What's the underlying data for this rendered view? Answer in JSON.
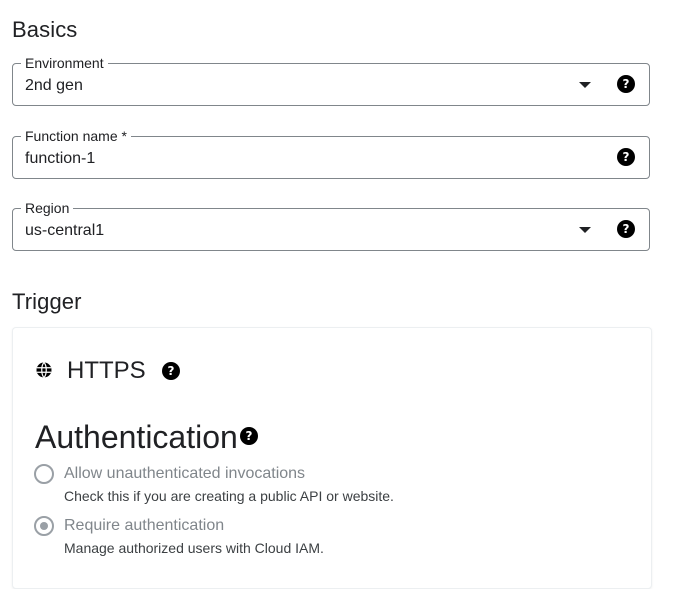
{
  "basics": {
    "title": "Basics",
    "environment": {
      "label": "Environment",
      "value": "2nd gen",
      "help_icon": "help-icon"
    },
    "function_name": {
      "label": "Function name *",
      "value": "function-1",
      "help_icon": "help-icon"
    },
    "region": {
      "label": "Region",
      "value": "us-central1",
      "help_icon": "help-icon"
    }
  },
  "trigger": {
    "title": "Trigger",
    "type_label": "HTTPS",
    "type_icon": "globe-icon",
    "authentication": {
      "title": "Authentication",
      "options": [
        {
          "label": "Allow unauthenticated invocations",
          "help": "Check this if you are creating a public API or website.",
          "selected": false
        },
        {
          "label": "Require authentication",
          "help": "Manage authorized users with Cloud IAM.",
          "selected": true
        }
      ]
    }
  },
  "colors": {
    "border": "#80868b",
    "text": "#202124",
    "disabled_text": "#80868b"
  }
}
